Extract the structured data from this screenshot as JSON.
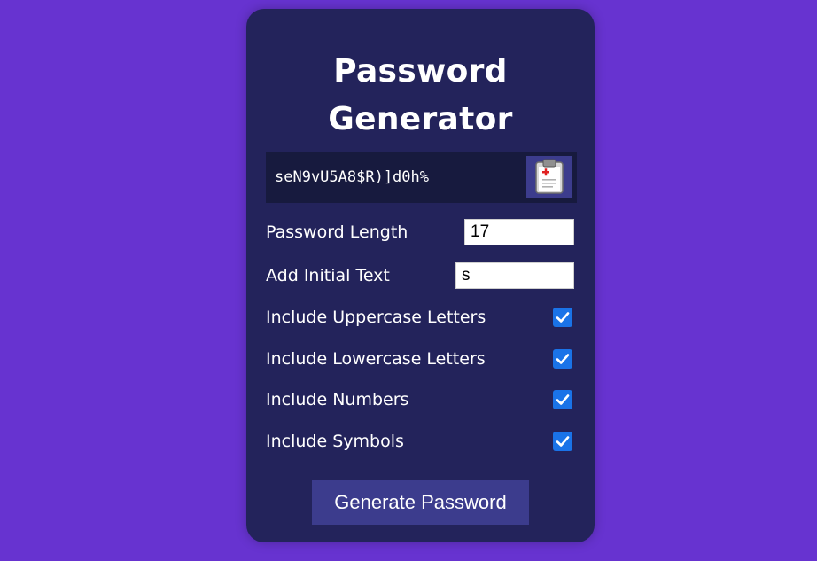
{
  "app": {
    "title_line1": "Password",
    "title_line2": "Generator"
  },
  "result": {
    "password": "seN9vU5A8$R)]d0h%",
    "copy_icon": "clipboard-icon"
  },
  "settings": {
    "length_label": "Password Length",
    "length_value": "17",
    "initial_text_label": "Add Initial Text",
    "initial_text_value": "s",
    "options": [
      {
        "label": "Include Uppercase Letters",
        "checked": true
      },
      {
        "label": "Include Lowercase Letters",
        "checked": true
      },
      {
        "label": "Include Numbers",
        "checked": true
      },
      {
        "label": "Include Symbols",
        "checked": true
      }
    ]
  },
  "actions": {
    "generate_label": "Generate Password"
  },
  "colors": {
    "page_background": "#6733d0",
    "card_background": "#23235b",
    "result_background": "#171a3e",
    "button_background": "#3c3c8d",
    "checkbox_accent": "#1a73e8"
  }
}
